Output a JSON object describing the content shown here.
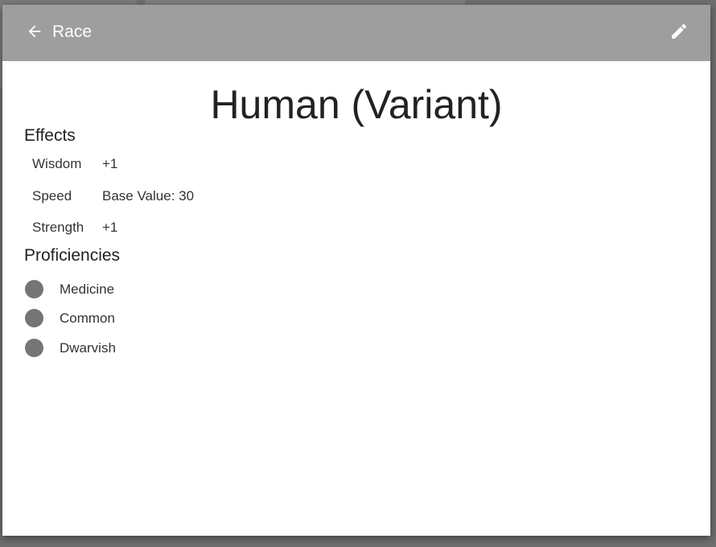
{
  "header": {
    "title": "Race",
    "back_icon": "arrow-left-icon",
    "edit_icon": "pencil-icon",
    "color": "#9e9e9e"
  },
  "page": {
    "title": "Human (Variant)"
  },
  "effects": {
    "title": "Effects",
    "items": [
      {
        "name": "Wisdom",
        "value": "+1"
      },
      {
        "name": "Speed",
        "value": "Base Value: 30"
      },
      {
        "name": "Strength",
        "value": "+1"
      }
    ]
  },
  "proficiencies": {
    "title": "Proficiencies",
    "dot_color": "#757575",
    "items": [
      {
        "label": "Medicine"
      },
      {
        "label": "Common"
      },
      {
        "label": "Dwarvish"
      }
    ]
  }
}
